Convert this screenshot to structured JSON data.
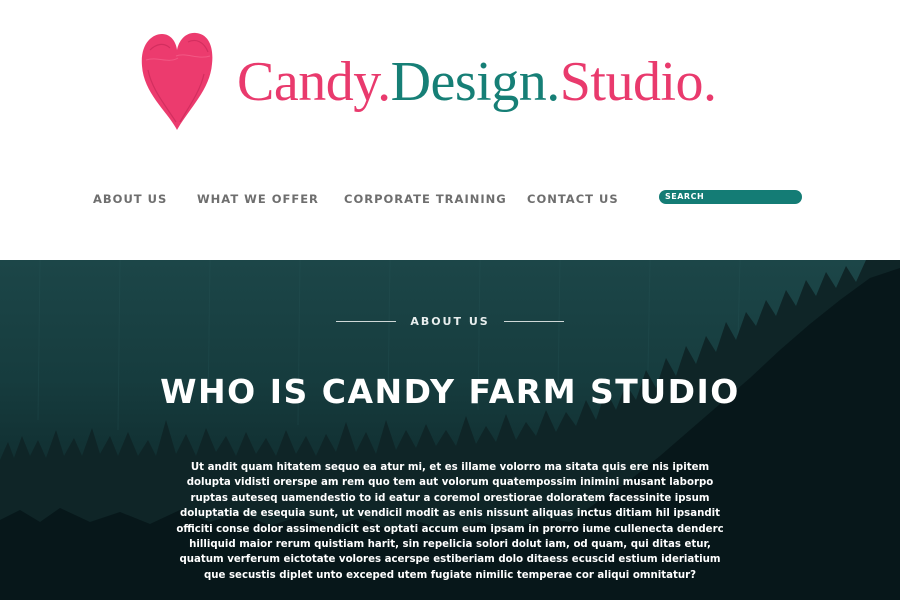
{
  "brand": {
    "parts": [
      "Candy.",
      "Design.",
      "Studio."
    ],
    "colors": {
      "pink": "#e93a6d",
      "teal": "#167f76"
    },
    "logo_icon": "heart-icon"
  },
  "nav": {
    "items": [
      {
        "label": "ABOUT US"
      },
      {
        "label": "WHAT WE OFFER"
      },
      {
        "label": "CORPORATE TRAINING"
      },
      {
        "label": "CONTACT US"
      }
    ],
    "text_color": "#6e6e6e"
  },
  "search": {
    "placeholder": "SEARCH",
    "background": "#147c75"
  },
  "hero": {
    "eyebrow": "ABOUT US",
    "title": "WHO IS CANDY FARM STUDIO",
    "body": "Ut andit quam hitatem sequo ea atur mi, et es illame volorro ma sitata quis ere nis ipitem dolupta vidisti orerspe am rem quo tem aut volorum quatempossim inimini musant laborpo ruptas auteseq uamendestio to id eatur a coremol orestiorae doloratem facessinite ipsum doluptatia de esequia sunt, ut vendicil modit as enis nissunt aliquas inctus ditiam hil ipsandit officiti conse dolor assimendicit est optati accum eum ipsam in prorro iume cullenecta denderc hilliquid maior rerum quistiam harit, sin repelicia solori dolut iam, od quam, qui ditas etur, quatum verferum eictotate volores acerspe estiberiam dolo ditaess ecuscid estium ideriatium que secustis diplet unto exceped utem fugiate nimilic temperae cor aliqui omnitatur?",
    "background": "#163c3e"
  }
}
